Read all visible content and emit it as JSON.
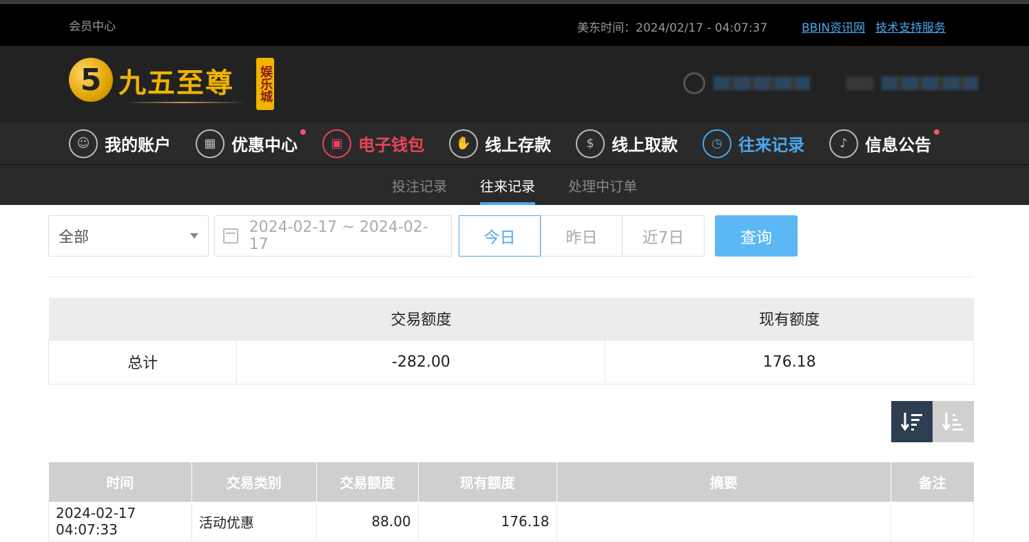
{
  "topbar": {
    "member_center": "会员中心",
    "time_label": "美东时间：2024/02/17 - 04:07:37",
    "link_bbin": "BBIN资讯网",
    "link_support": "技术支持服务"
  },
  "logo": {
    "main": "九五至尊",
    "vertical": "娱乐城",
    "badge": "5"
  },
  "nav": [
    {
      "label": "我的账户"
    },
    {
      "label": "优惠中心"
    },
    {
      "label": "电子钱包"
    },
    {
      "label": "线上存款"
    },
    {
      "label": "线上取款"
    },
    {
      "label": "往来记录"
    },
    {
      "label": "信息公告"
    }
  ],
  "subnav": [
    {
      "label": "投注记录"
    },
    {
      "label": "往来记录"
    },
    {
      "label": "处理中订单"
    }
  ],
  "filters": {
    "type_value": "全部",
    "date_range": "2024-02-17 ~ 2024-02-17",
    "today": "今日",
    "yesterday": "昨日",
    "last7": "近7日",
    "query": "查询"
  },
  "summary": {
    "headers": [
      "",
      "交易额度",
      "现有额度"
    ],
    "row": [
      "总计",
      "-282.00",
      "176.18"
    ]
  },
  "records": {
    "headers": [
      "时间",
      "交易类别",
      "交易额度",
      "现有额度",
      "摘要",
      "备注"
    ],
    "rows": [
      [
        "2024-02-17 04:07:33",
        "活动优惠",
        "88.00",
        "176.18",
        "",
        ""
      ]
    ]
  },
  "colors": {
    "accent": "#4aa8f0",
    "alert": "#e8455a",
    "gold": "#f0b400"
  }
}
